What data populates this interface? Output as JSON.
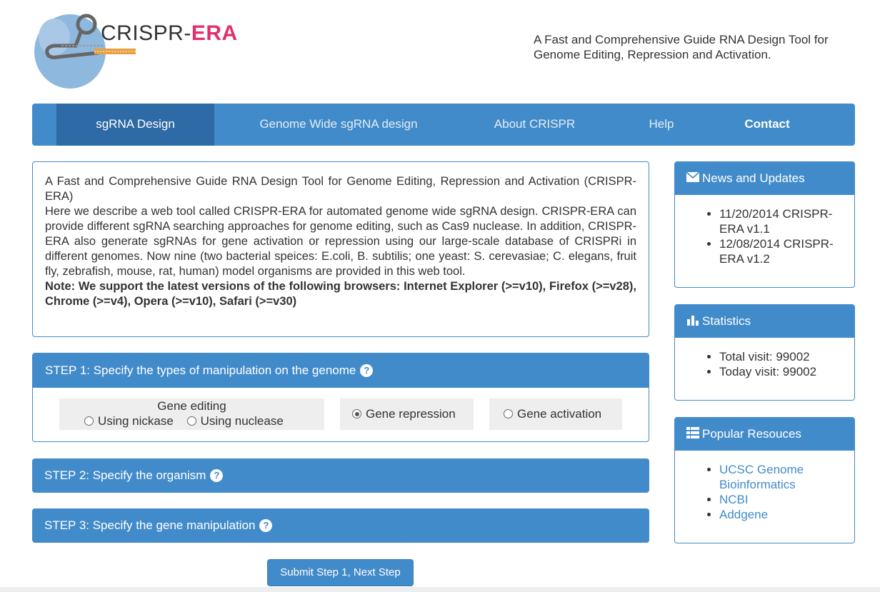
{
  "header": {
    "logo_text": "CRISPR-",
    "logo_text_era": "ERA",
    "tagline_line1": "A Fast and Comprehensive Guide RNA Design Tool for",
    "tagline_line2": "Genome Editing, Repression and Activation."
  },
  "nav": {
    "items": [
      {
        "label": "sgRNA Design"
      },
      {
        "label": "Genome Wide sgRNA design"
      },
      {
        "label": "About CRISPR"
      },
      {
        "label": "Help"
      },
      {
        "label": "Contact"
      }
    ]
  },
  "intro": {
    "title": "A Fast and Comprehensive Guide RNA Design Tool for Genome Editing, Repression and Activation (CRISPR-ERA)",
    "body": "Here we describe a web tool called CRISPR-ERA for automated genome wide sgRNA design. CRISPR-ERA can provide different sgRNA searching approaches for genome editing, such as Cas9 nuclease. In addition, CRISPR-ERA also generate sgRNAs for gene activation or repression using our large-scale database of CRISPRi in different genomes. Now nine (two bacterial speices: E.coli, B. subtilis; one yeast: S. cerevasiae; C. elegans, fruit fly, zebrafish, mouse, rat, human) model organisms are provided in this web tool.",
    "note": "Note: We support the latest versions of the following browsers: Internet Explorer (>=v10), Firefox (>=v28), Chrome (>=v4), Opera (>=v10), Safari (>=v30)"
  },
  "step1": {
    "heading": "STEP 1: Specify the types of manipulation on the genome",
    "gene_editing_label": "Gene editing",
    "option_nickase": "Using nickase",
    "option_nuclease": "Using nuclease",
    "option_repression": "Gene repression",
    "option_activation": "Gene activation",
    "selected": "Gene repression"
  },
  "step2": {
    "heading": "STEP 2: Specify the organism"
  },
  "step3": {
    "heading": "STEP 3: Specify the gene manipulation"
  },
  "submit_label": "Submit Step 1, Next Step",
  "help_glyph": "?",
  "sidebar": {
    "news": {
      "title": "News and Updates",
      "items": [
        "11/20/2014 CRISPR-ERA v1.1",
        "12/08/2014 CRISPR-ERA v1.2"
      ]
    },
    "stats": {
      "title": "Statistics",
      "items": [
        "Total visit: 99002",
        "Today visit: 99002"
      ]
    },
    "resources": {
      "title": "Popular Resouces",
      "links": [
        "UCSC Genome Bioinformatics",
        "NCBI",
        "Addgene"
      ]
    }
  },
  "colors": {
    "primary": "#428bca",
    "nav_active": "#2d6aa6",
    "option_bg": "#eeeeee",
    "logo_era": "#e03070"
  },
  "icons": {
    "news": "envelope-icon",
    "stats": "bar-chart-icon",
    "resources": "list-icon",
    "help": "question-circle-icon"
  }
}
